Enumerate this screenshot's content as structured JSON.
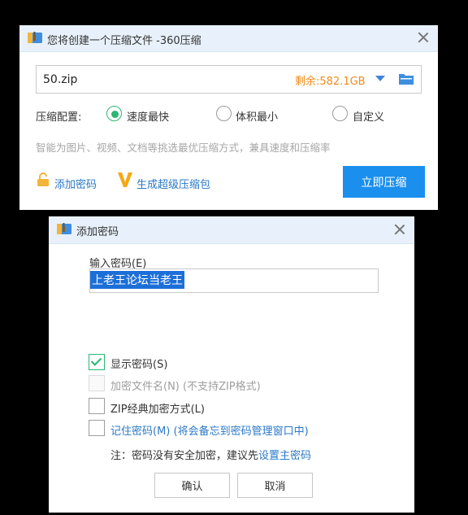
{
  "compress_window": {
    "title": "您将创建一个压缩文件 -360压缩",
    "filename_value": "50.zip",
    "free_space": "剩余:582.1GB",
    "config_label": "压缩配置:",
    "options": [
      "速度最快",
      "体积最小",
      "自定义"
    ],
    "selected_option": "速度最快",
    "hint": "智能为图片、视频、文档等挑选最优压缩方式，兼具速度和压缩率",
    "add_password_link": "添加密码",
    "super_package_link": "生成超级压缩包",
    "compress_button": "立即压缩"
  },
  "password_dialog": {
    "title": "添加密码",
    "password_label": "输入密码(E)",
    "password_value": "上老王论坛当老王",
    "checkboxes": [
      {
        "label": "显示密码(S)",
        "checked": true,
        "disabled": false
      },
      {
        "label": "加密文件名(N) (不支持ZIP格式)",
        "checked": false,
        "disabled": true
      },
      {
        "label": "ZIP经典加密方式(L)",
        "checked": false,
        "disabled": false
      },
      {
        "label": "记住密码(M) (将会备忘到密码管理窗口中)",
        "checked": false,
        "disabled": false
      }
    ],
    "note_prefix": "注：密码没有安全加密，建议先",
    "note_link": "设置主密码",
    "ok_button": "确认",
    "cancel_button": "取消"
  },
  "colors": {
    "accent": "#1a8fee",
    "link": "#2a78c7",
    "free_space": "#f08b1a",
    "check_green": "#2bb673",
    "titlebar": "#e8f1fb"
  }
}
